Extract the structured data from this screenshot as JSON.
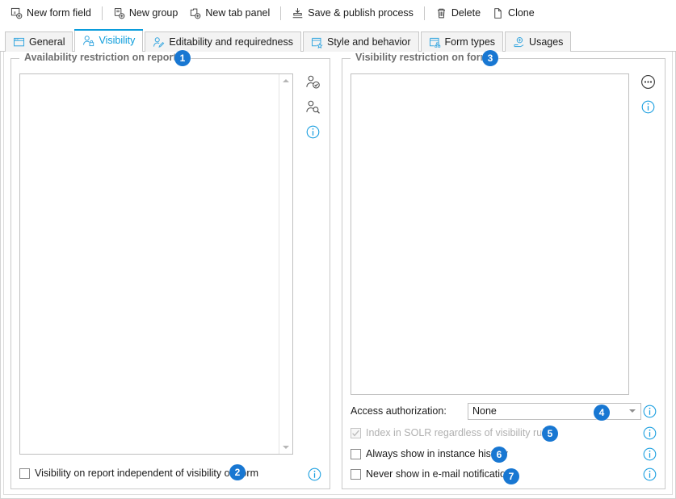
{
  "toolbar": {
    "items": [
      {
        "icon": "new-form-field-icon",
        "label": "New form field",
        "sep_after": true
      },
      {
        "icon": "new-group-icon",
        "label": "New group",
        "sep_after": false
      },
      {
        "icon": "new-tab-panel-icon",
        "label": "New tab panel",
        "sep_after": true
      },
      {
        "icon": "save-publish-icon",
        "label": "Save & publish process",
        "sep_after": true
      },
      {
        "icon": "delete-icon",
        "label": "Delete",
        "sep_after": false
      },
      {
        "icon": "clone-icon",
        "label": "Clone",
        "sep_after": false
      }
    ]
  },
  "tabs": [
    {
      "icon": "general-window-icon",
      "label": "General",
      "active": false
    },
    {
      "icon": "visibility-user-lock-icon",
      "label": "Visibility",
      "active": true
    },
    {
      "icon": "editability-user-pencil-icon",
      "label": "Editability and requiredness",
      "active": false
    },
    {
      "icon": "style-window-star-icon",
      "label": "Style and behavior",
      "active": false
    },
    {
      "icon": "form-types-icon",
      "label": "Form types",
      "active": false
    },
    {
      "icon": "usages-icon",
      "label": "Usages",
      "active": false
    }
  ],
  "left_panel": {
    "title": "Availability restriction on reports",
    "badge": "1",
    "list_value": "",
    "rail": [
      {
        "name": "assign-user-icon",
        "title": "Assign user"
      },
      {
        "name": "search-user-icon",
        "title": "Search user"
      },
      {
        "name": "info-icon",
        "title": "Info"
      }
    ],
    "checkbox": {
      "label": "Visibility on report independent of visibility on form",
      "checked": false,
      "disabled": false,
      "badge": "2"
    },
    "info_icon": "info-icon"
  },
  "right_panel": {
    "title": "Visibility restriction on form",
    "badge": "3",
    "list_value": "",
    "rail": [
      {
        "name": "ellipsis-icon",
        "title": "More"
      },
      {
        "name": "info-icon",
        "title": "Info"
      }
    ],
    "access_authorization": {
      "label": "Access authorization:",
      "value": "None",
      "badge": "4",
      "info_icon": "info-icon"
    },
    "checkboxes": [
      {
        "label": "Index in SOLR regardless of visibility rules",
        "checked": true,
        "disabled": true,
        "badge": "5",
        "info_icon": "info-icon"
      },
      {
        "label": "Always show in instance history",
        "checked": false,
        "disabled": false,
        "badge": "6",
        "info_icon": "info-icon"
      },
      {
        "label": "Never show in e-mail notifications",
        "checked": false,
        "disabled": false,
        "badge": "7",
        "info_icon": "info-icon"
      }
    ]
  },
  "colors": {
    "accent_blue": "#0a9cdb",
    "badge_blue": "#1877d2",
    "border_grey": "#c8c8c8",
    "title_grey": "#6f6f6f",
    "disabled_grey": "#b0b0b0"
  }
}
